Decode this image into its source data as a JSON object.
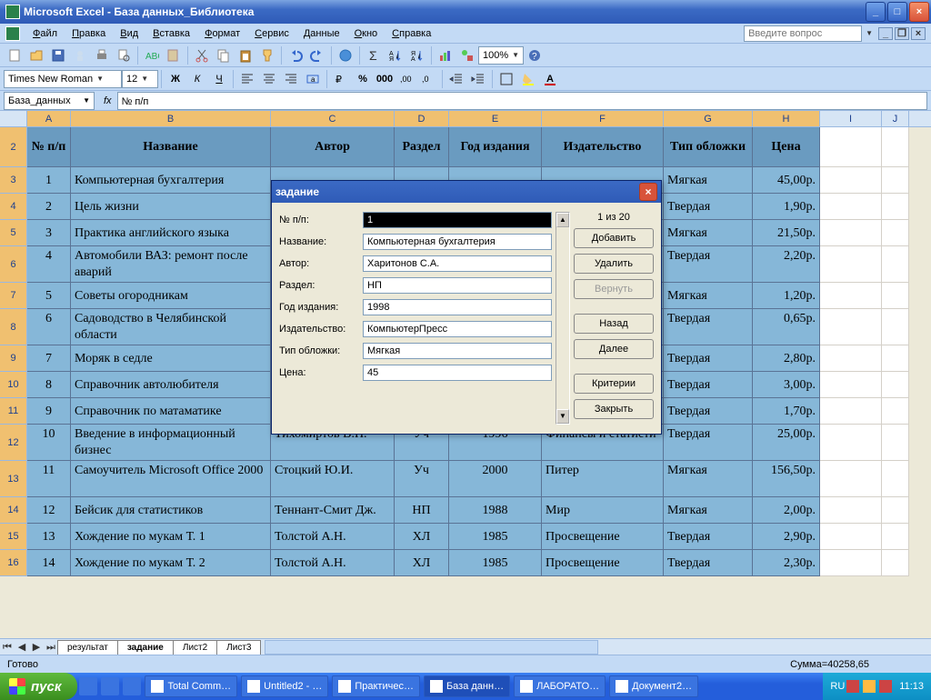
{
  "window": {
    "title": "Microsoft Excel - База данных_Библиотека",
    "help_placeholder": "Введите вопрос"
  },
  "menu": [
    "Файл",
    "Правка",
    "Вид",
    "Вставка",
    "Формат",
    "Сервис",
    "Данные",
    "Окно",
    "Справка"
  ],
  "font": {
    "name": "Times New Roman",
    "size": "12"
  },
  "zoom": "100%",
  "namebox": "База_данных",
  "formula": "№ п/п",
  "columns": [
    "A",
    "B",
    "C",
    "D",
    "E",
    "F",
    "G",
    "H",
    "I",
    "J"
  ],
  "headers": {
    "A": "№ п/п",
    "B": "Название",
    "C": "Автор",
    "D": "Раздел",
    "E": "Год издания",
    "F": "Издательство",
    "G": "Тип обложки",
    "H": "Цена"
  },
  "rows": [
    {
      "r": 3,
      "n": "1",
      "title": "Компьютерная бухгалтерия",
      "g": "Мягкая",
      "price": "45,00р."
    },
    {
      "r": 4,
      "n": "2",
      "title": "Цель жизни",
      "g": "Твердая",
      "price": "1,90р."
    },
    {
      "r": 5,
      "n": "3",
      "title": "Практика английского языка",
      "g": "Мягкая",
      "price": "21,50р."
    },
    {
      "r": 6,
      "n": "4",
      "title": "Автомобили ВАЗ: ремонт после аварий",
      "tall": true,
      "g": "Твердая",
      "price": "2,20р."
    },
    {
      "r": 7,
      "n": "5",
      "title": "Советы огородникам",
      "g": "Мягкая",
      "price": "1,20р."
    },
    {
      "r": 8,
      "n": "6",
      "title": "Садоводство в Челябинской области",
      "tall": true,
      "g": "Твердая",
      "price": "0,65р."
    },
    {
      "r": 9,
      "n": "7",
      "title": "Моряк в седле",
      "g": "Твердая",
      "price": "2,80р."
    },
    {
      "r": 10,
      "n": "8",
      "title": "Справочник автолюбителя",
      "g": "Твердая",
      "price": "3,00р."
    },
    {
      "r": 11,
      "n": "9",
      "title": "Справочник по матаматике",
      "g": "Твердая",
      "price": "1,70р."
    },
    {
      "r": 12,
      "n": "10",
      "title": "Введение в информационный бизнес",
      "tall": true,
      "author": "Тихомиртов В.П.",
      "sec": "Уч",
      "year": "1996",
      "pub": "Финансы и статисти",
      "g": "Твердая",
      "price": "25,00р."
    },
    {
      "r": 13,
      "n": "11",
      "title": "Самоучитель Microsoft Office 2000",
      "tall": true,
      "author": "Стоцкий Ю.И.",
      "sec": "Уч",
      "year": "2000",
      "pub": "Питер",
      "g": "Мягкая",
      "price": "156,50р."
    },
    {
      "r": 14,
      "n": "12",
      "title": "Бейсик для статистиков",
      "author": "Теннант-Смит Дж.",
      "sec": "НП",
      "year": "1988",
      "pub": "Мир",
      "g": "Мягкая",
      "price": "2,00р."
    },
    {
      "r": 15,
      "n": "13",
      "title": "Хождение по мукам Т. 1",
      "author": "Толстой А.Н.",
      "sec": "ХЛ",
      "year": "1985",
      "pub": "Просвещение",
      "g": "Твердая",
      "price": "2,90р."
    },
    {
      "r": 16,
      "n": "14",
      "title": "Хождение по мукам Т. 2",
      "author": "Толстой А.Н.",
      "sec": "ХЛ",
      "year": "1985",
      "pub": "Просвещение",
      "g": "Твердая",
      "price": "2,30р."
    }
  ],
  "sheets": [
    "результат",
    "задание",
    "Лист2",
    "Лист3"
  ],
  "active_sheet": 1,
  "status": {
    "ready": "Готово",
    "sum": "Сумма=40258,65"
  },
  "dialog": {
    "title": "задание",
    "counter": "1 из 20",
    "fields": [
      {
        "label": "№ п/п:",
        "value": "1",
        "sel": true
      },
      {
        "label": "Название:",
        "value": "Компьютерная бухгалтерия"
      },
      {
        "label": "Автор:",
        "value": "Харитонов С.А."
      },
      {
        "label": "Раздел:",
        "value": "НП"
      },
      {
        "label": "Год издания:",
        "value": "1998"
      },
      {
        "label": "Издательство:",
        "value": "КомпьютерПресс"
      },
      {
        "label": "Тип обложки:",
        "value": "Мягкая"
      },
      {
        "label": "Цена:",
        "value": "45"
      }
    ],
    "buttons": {
      "add": "Добавить",
      "del": "Удалить",
      "revert": "Вернуть",
      "prev": "Назад",
      "next": "Далее",
      "criteria": "Критерии",
      "close": "Закрыть"
    }
  },
  "taskbar": {
    "start": "пуск",
    "tasks": [
      "Total Comm…",
      "Untitled2 - …",
      "Практичес…",
      "База данн…",
      "ЛАБОРАТО…",
      "Документ2…"
    ],
    "active_task": 3,
    "lang": "RU",
    "clock": "11:13"
  }
}
